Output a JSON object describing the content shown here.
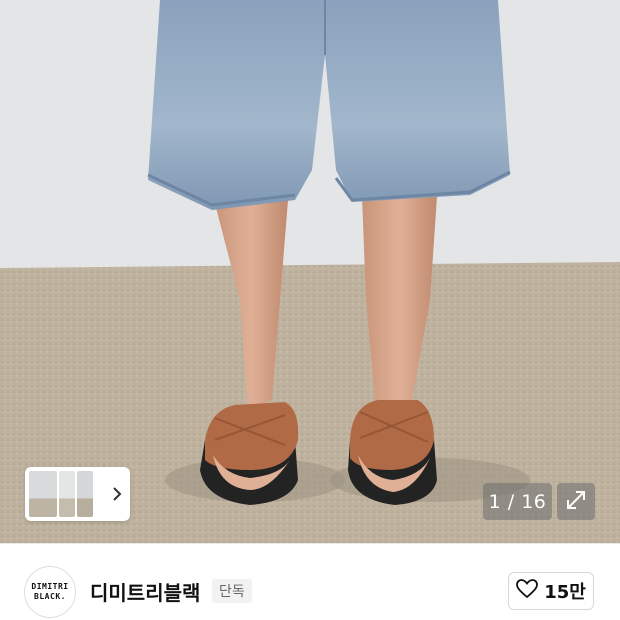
{
  "gallery": {
    "counter": "1 / 16",
    "thumbnails": [
      "product-photo-1",
      "product-photo-2",
      "product-photo-3"
    ]
  },
  "brand": {
    "logo_line1": "DIMITRI",
    "logo_line2": "BLACK.",
    "name": "디미트리블랙",
    "badge": "단독"
  },
  "like": {
    "count": "15만"
  },
  "icons": {
    "expand": "expand-icon",
    "heart": "heart-icon",
    "next": "chevron-right-icon"
  },
  "colors": {
    "counter_bg": "#6e6e6e",
    "badge_bg": "#f2f2f2",
    "text": "#111111"
  }
}
